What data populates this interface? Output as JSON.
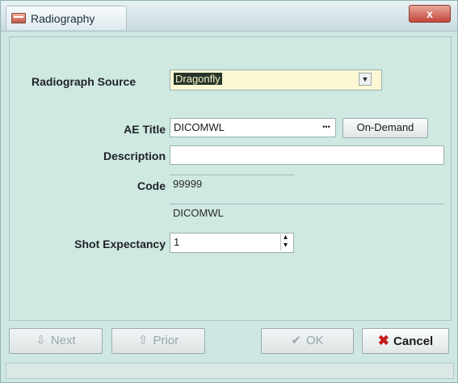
{
  "window": {
    "title": "Radiography",
    "close_glyph": "x"
  },
  "form": {
    "source": {
      "label": "Radiograph Source",
      "value": "Dragonfly"
    },
    "ae_title": {
      "label": "AE Title",
      "value": "DICOMWL",
      "browse_label": "•••",
      "on_demand_label": "On-Demand"
    },
    "description": {
      "label": "Description",
      "value": ""
    },
    "code": {
      "label": "Code",
      "value": "99999",
      "secondary_value": "DICOMWL"
    },
    "shot_expectancy": {
      "label": "Shot Expectancy",
      "value": "1",
      "spin_up": "▴",
      "spin_down": "▾"
    }
  },
  "buttons": {
    "next": {
      "label": "Next",
      "icon": "⇩",
      "enabled": false
    },
    "prior": {
      "label": "Prior",
      "icon": "⇧",
      "enabled": false
    },
    "ok": {
      "label": "OK",
      "icon": "✔",
      "enabled": false
    },
    "cancel": {
      "label": "Cancel",
      "icon": "✖",
      "enabled": true
    }
  },
  "colors": {
    "panel_bg": "#cfe8e1",
    "selection_bg": "#27352a",
    "cancel_icon": "#c51b1b"
  }
}
